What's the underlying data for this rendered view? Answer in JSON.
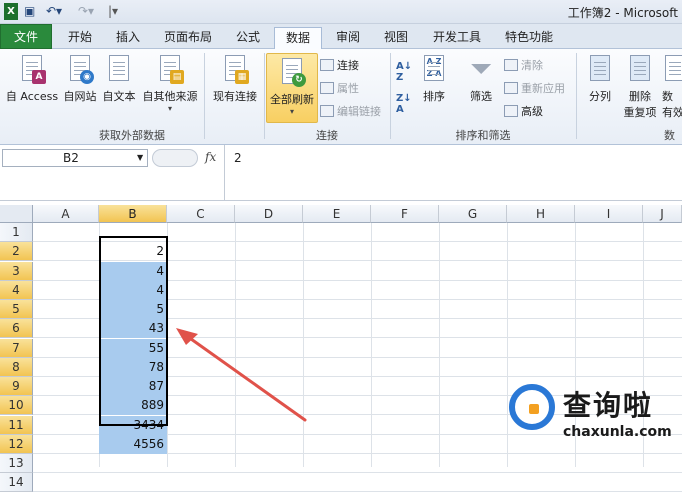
{
  "window": {
    "title": "工作簿2 - Microsoft"
  },
  "tabs": [
    "文件",
    "开始",
    "插入",
    "页面布局",
    "公式",
    "数据",
    "审阅",
    "视图",
    "开发工具",
    "特色功能"
  ],
  "ribbon": {
    "external": {
      "buttons": [
        "自 Access",
        "自网站",
        "自文本",
        "自其他来源"
      ],
      "existing": "现有连接",
      "label": "获取外部数据"
    },
    "connections": {
      "refresh_all": "全部刷新",
      "items": [
        "连接",
        "属性",
        "编辑链接"
      ],
      "label": "连接"
    },
    "sortfilter": {
      "sort": "排序",
      "filter": "筛选",
      "items": [
        "清除",
        "重新应用",
        "高级"
      ],
      "label": "排序和筛选"
    },
    "tools": {
      "split": "分列",
      "remove_dup_1": "删除",
      "remove_dup_2": "重复项",
      "valid_1": "数",
      "valid_2": "有效",
      "label": "数"
    }
  },
  "formula": {
    "namebox": "B2",
    "fx": "fx",
    "value": "2"
  },
  "columns": [
    "A",
    "B",
    "C",
    "D",
    "E",
    "F",
    "G",
    "H",
    "I",
    "J"
  ],
  "rows": [
    "1",
    "2",
    "3",
    "4",
    "5",
    "6",
    "7",
    "8",
    "9",
    "10",
    "11",
    "12",
    "13",
    "14"
  ],
  "cells_b": [
    "",
    "2",
    "4",
    "4",
    "5",
    "43",
    "55",
    "78",
    "87",
    "889",
    "3434",
    "4556",
    "",
    ""
  ],
  "logo": {
    "text": "查询啦",
    "domain": "chaxunla.com"
  },
  "colors": {
    "file_tab": "#2a8a3c",
    "selection": "#a8cbee",
    "arrow": "#e0524a"
  }
}
